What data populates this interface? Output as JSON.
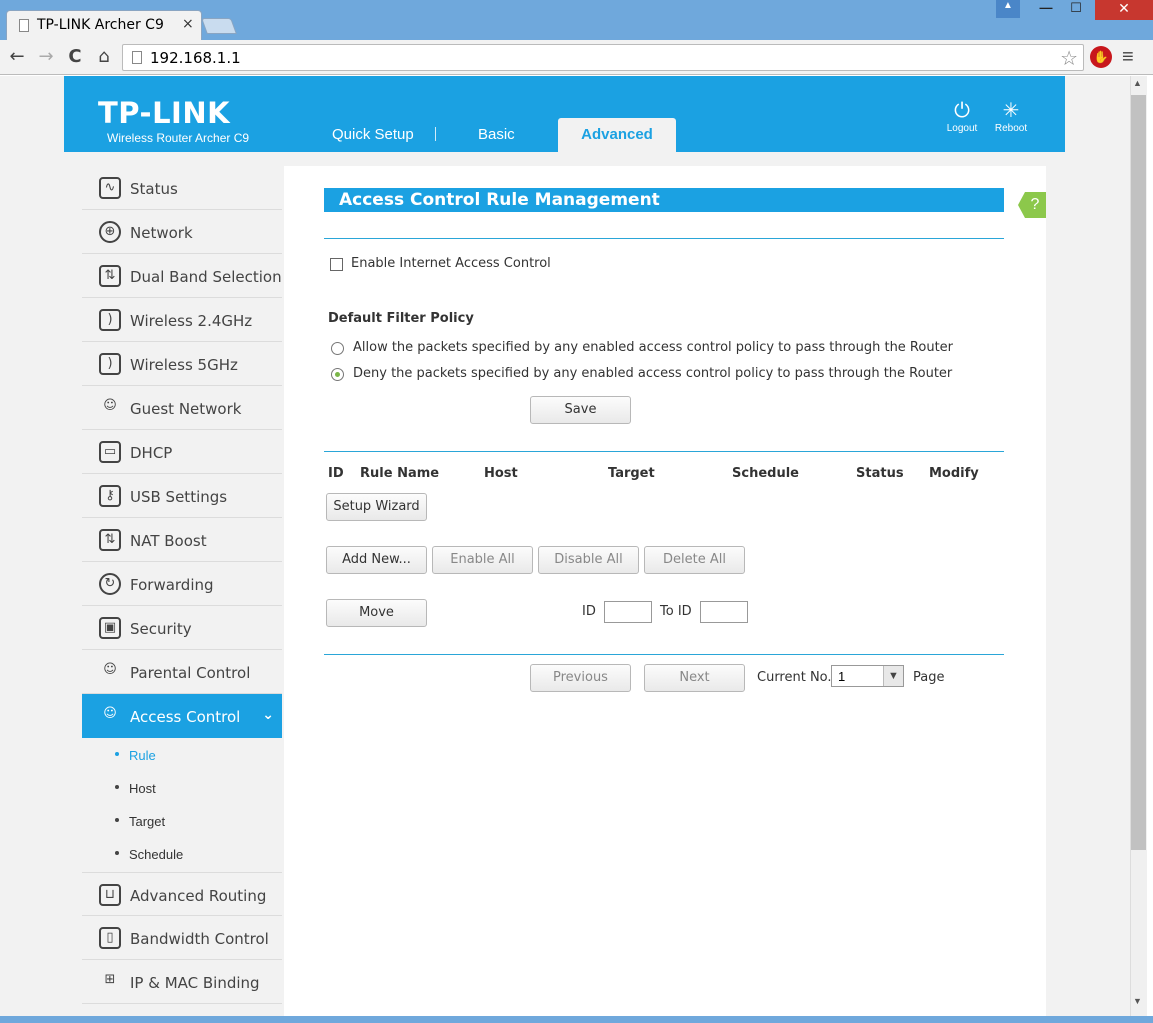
{
  "browser": {
    "tab_title": "TP-LINK Archer C9",
    "tab_close": "×",
    "url": "192.168.1.1",
    "nav": {
      "back": "←",
      "forward": "→",
      "reload": "C",
      "home": "⌂"
    }
  },
  "header": {
    "logo": "TP-LINK",
    "model": "Wireless Router Archer C9",
    "nav": {
      "quick_setup": "Quick Setup",
      "basic": "Basic",
      "advanced": "Advanced"
    },
    "logout": "Logout",
    "reboot": "Reboot"
  },
  "sidebar": {
    "items": [
      {
        "label": "Status",
        "icon": "status-icon",
        "glyph": "∿"
      },
      {
        "label": "Network",
        "icon": "globe-icon",
        "glyph": "⊕"
      },
      {
        "label": "Dual Band Selection",
        "icon": "dual-band-icon",
        "glyph": "⇅"
      },
      {
        "label": "Wireless 2.4GHz",
        "icon": "wifi-icon",
        "glyph": ")"
      },
      {
        "label": "Wireless 5GHz",
        "icon": "wifi-icon",
        "glyph": ")"
      },
      {
        "label": "Guest Network",
        "icon": "guest-icon",
        "glyph": "☺"
      },
      {
        "label": "DHCP",
        "icon": "monitor-icon",
        "glyph": "▭"
      },
      {
        "label": "USB Settings",
        "icon": "usb-icon",
        "glyph": "⚷"
      },
      {
        "label": "NAT Boost",
        "icon": "nat-icon",
        "glyph": "⇅"
      },
      {
        "label": "Forwarding",
        "icon": "forwarding-icon",
        "glyph": "↻"
      },
      {
        "label": "Security",
        "icon": "lock-icon",
        "glyph": "▣"
      },
      {
        "label": "Parental Control",
        "icon": "parental-icon",
        "glyph": "☺"
      },
      {
        "label": "Access Control",
        "icon": "access-control-icon",
        "glyph": "☺"
      }
    ],
    "access_control_chevron": "⌄",
    "sub_items": [
      "Rule",
      "Host",
      "Target",
      "Schedule"
    ],
    "items_after": [
      {
        "label": "Advanced Routing",
        "icon": "routing-icon",
        "glyph": "⊔"
      },
      {
        "label": "Bandwidth Control",
        "icon": "bandwidth-icon",
        "glyph": "▯"
      },
      {
        "label": "IP & MAC Binding",
        "icon": "binding-icon",
        "glyph": "⊞"
      }
    ]
  },
  "main": {
    "title": "Access Control Rule Management",
    "help": "?",
    "enable_label": "Enable Internet Access Control",
    "enable_checked": false,
    "policy_heading": "Default Filter Policy",
    "policy_allow": "Allow the packets specified by any enabled access control policy to pass through the Router",
    "policy_deny": "Deny the packets specified by any enabled access control policy to pass through the Router",
    "policy_selected": "deny",
    "save": "Save",
    "table_headers": [
      "ID",
      "Rule Name",
      "Host",
      "Target",
      "Schedule",
      "Status",
      "Modify"
    ],
    "setup_wizard": "Setup Wizard",
    "add_new": "Add New...",
    "enable_all": "Enable All",
    "disable_all": "Disable All",
    "delete_all": "Delete All",
    "move": "Move",
    "id_label": "ID",
    "to_id_label": "To ID",
    "previous": "Previous",
    "next": "Next",
    "current_no_label": "Current No.",
    "current_no": "1",
    "page_label": "Page"
  },
  "colors": {
    "accent": "#1ba1e2",
    "help": "#8cc84b",
    "radio_selected": "#7ab648"
  }
}
